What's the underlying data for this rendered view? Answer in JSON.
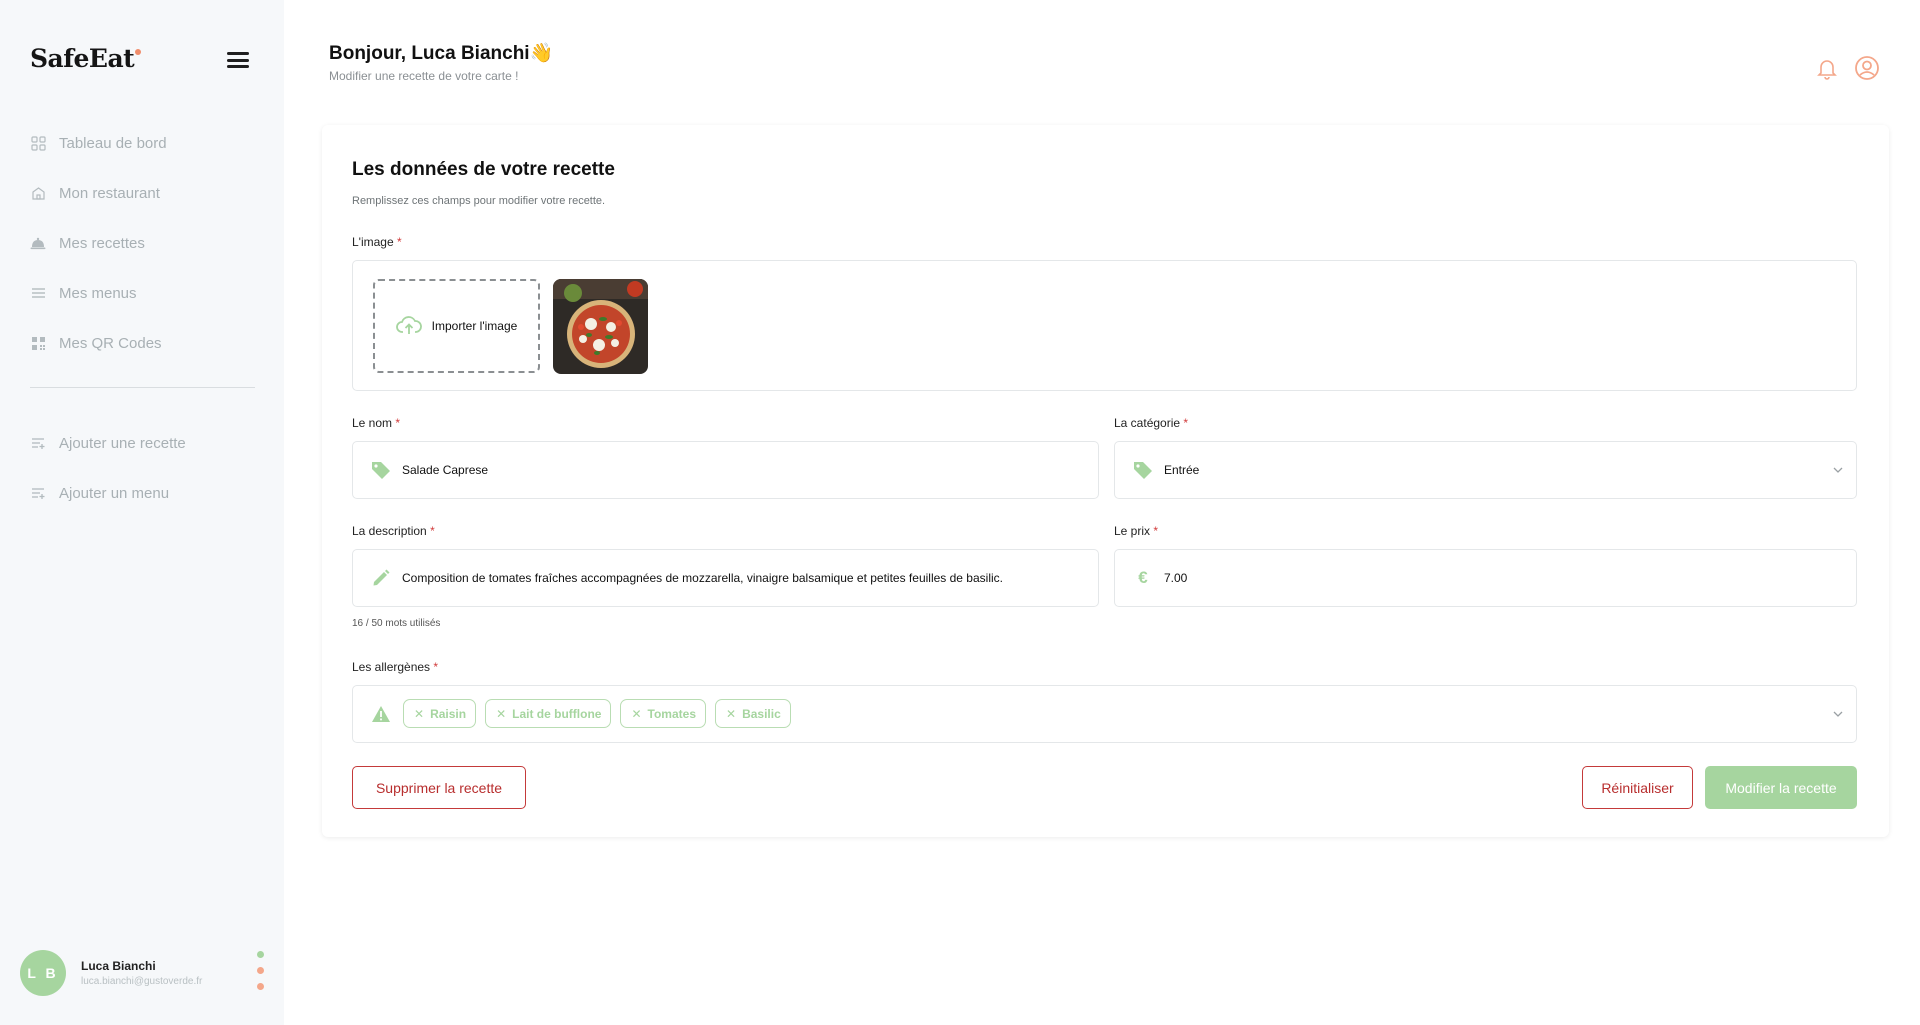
{
  "app": {
    "logo": "SafeEat"
  },
  "sidebar": {
    "nav_primary": [
      {
        "label": "Tableau de bord",
        "icon": "grid-icon"
      },
      {
        "label": "Mon restaurant",
        "icon": "store-icon"
      },
      {
        "label": "Mes recettes",
        "icon": "cloche-icon"
      },
      {
        "label": "Mes menus",
        "icon": "list-icon"
      },
      {
        "label": "Mes QR Codes",
        "icon": "qr-code-icon"
      }
    ],
    "nav_secondary": [
      {
        "label": "Ajouter une recette",
        "icon": "add-list-icon"
      },
      {
        "label": "Ajouter un menu",
        "icon": "add-list-icon"
      }
    ],
    "user": {
      "initials": "L B",
      "name": "Luca Bianchi",
      "email": "luca.bianchi@gustoverde.fr"
    },
    "status_colors": [
      "#a6d59f",
      "#f4a78a",
      "#f4a78a"
    ]
  },
  "header": {
    "greeting": "Bonjour, Luca Bianchi",
    "greeting_emoji": "👋",
    "subtitle": "Modifier une recette de votre carte !"
  },
  "form": {
    "title": "Les données de votre recette",
    "subtitle": "Remplissez ces champs pour modifier votre recette.",
    "required_mark": "*",
    "image": {
      "label": "L'image",
      "upload_label": "Importer l'image"
    },
    "name": {
      "label": "Le nom",
      "value": "Salade Caprese"
    },
    "category": {
      "label": "La catégorie",
      "value": "Entrée"
    },
    "description": {
      "label": "La description",
      "value": "Composition de tomates fraîches accompagnées de mozzarella, vinaigre balsamique et petites feuilles de basilic.",
      "word_count": "16 / 50 mots utilisés"
    },
    "price": {
      "label": "Le prix",
      "currency": "€",
      "value": "7.00"
    },
    "allergens": {
      "label": "Les allergènes",
      "tags": [
        "Raisin",
        "Lait de bufflone",
        "Tomates",
        "Basilic"
      ]
    },
    "buttons": {
      "delete": "Supprimer la recette",
      "reset": "Réinitialiser",
      "submit": "Modifier la recette"
    }
  },
  "colors": {
    "accent_green": "#a6d59f",
    "danger": "#c43a3a",
    "warm_orange": "#f4a78a"
  }
}
